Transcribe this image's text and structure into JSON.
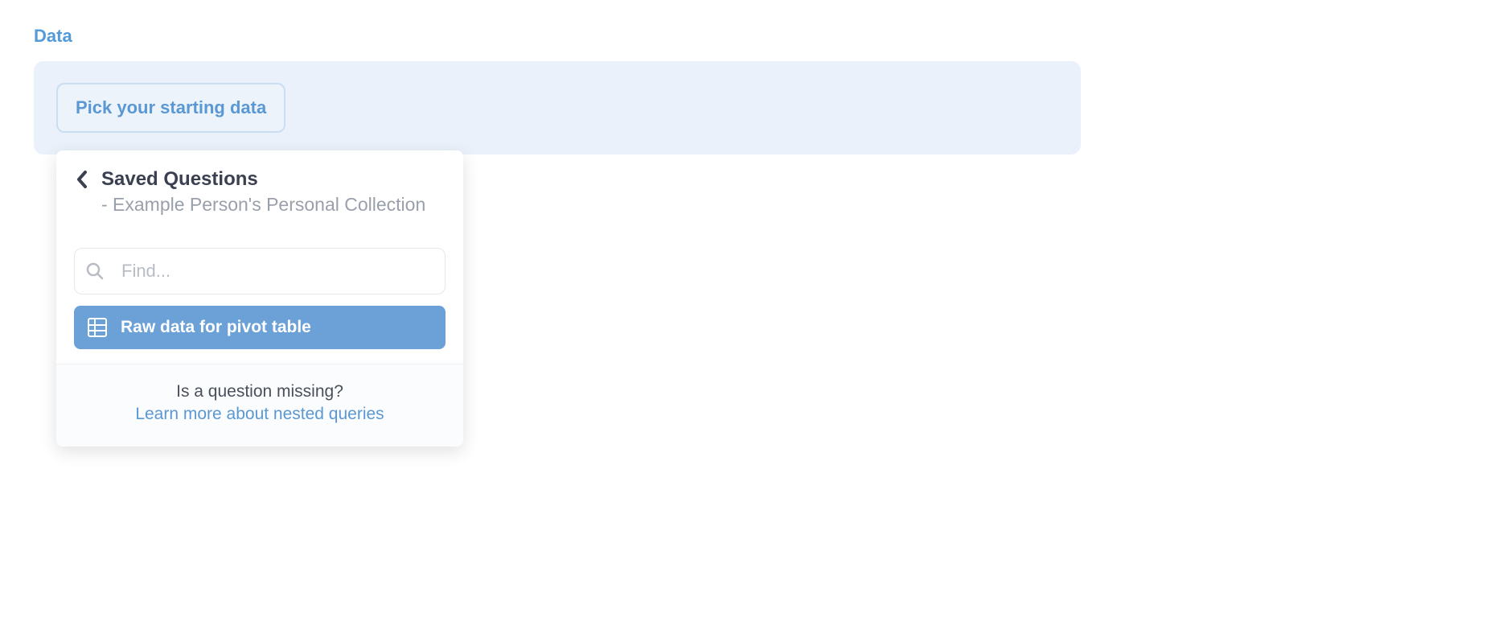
{
  "section": {
    "label": "Data"
  },
  "panel": {
    "pick_button": "Pick your starting data"
  },
  "popover": {
    "title": "Saved Questions",
    "subtitle": "- Example Person's Personal Collection",
    "search_placeholder": "Find...",
    "items": [
      {
        "label": "Raw data for pivot table"
      }
    ],
    "footer_question": "Is a question missing?",
    "footer_link": "Learn more about nested queries"
  }
}
